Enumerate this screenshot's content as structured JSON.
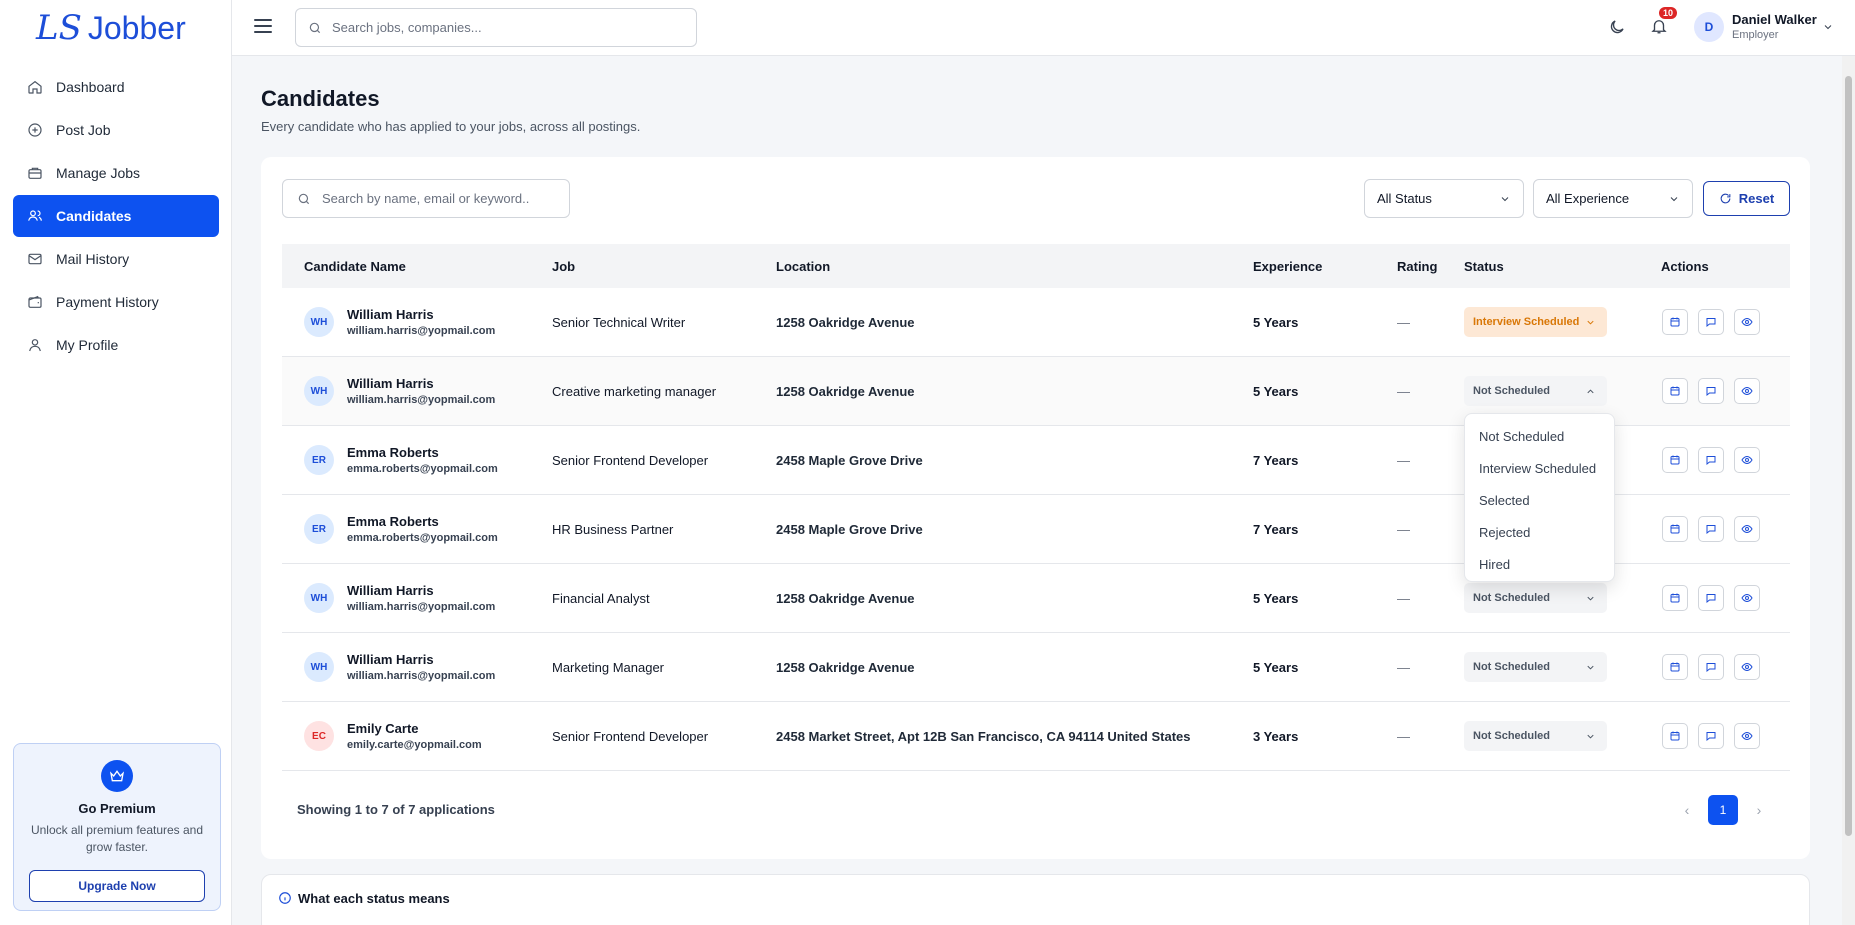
{
  "brand": {
    "logo_mark": "LS",
    "name": "Jobber"
  },
  "sidebar": {
    "items": [
      {
        "label": "Dashboard",
        "icon": "home-icon"
      },
      {
        "label": "Post Job",
        "icon": "plus-circle-icon"
      },
      {
        "label": "Manage Jobs",
        "icon": "briefcase-icon"
      },
      {
        "label": "Candidates",
        "icon": "users-icon",
        "active": true
      },
      {
        "label": "Mail History",
        "icon": "mail-icon"
      },
      {
        "label": "Payment History",
        "icon": "wallet-icon"
      },
      {
        "label": "My Profile",
        "icon": "user-icon"
      }
    ],
    "premium": {
      "title": "Go Premium",
      "text": "Unlock all premium features and grow faster.",
      "button": "Upgrade Now"
    }
  },
  "topbar": {
    "search_placeholder": "Search jobs, companies...",
    "notification_count": "10",
    "user": {
      "initial": "D",
      "name": "Daniel Walker",
      "role": "Employer"
    }
  },
  "page": {
    "title": "Candidates",
    "subtitle": "Every candidate who has applied to your jobs, across all postings."
  },
  "filters": {
    "search_placeholder": "Search by name, email or keyword..",
    "status_value": "All Status",
    "experience_value": "All Experience",
    "reset_label": "Reset"
  },
  "table": {
    "headers": [
      "Candidate Name",
      "Job",
      "Location",
      "Experience",
      "Rating",
      "Status",
      "Actions"
    ],
    "rows": [
      {
        "initials": "WH",
        "name": "William Harris",
        "email": "william.harris@yopmail.com",
        "job": "Senior Technical Writer",
        "location": "1258 Oakridge Avenue",
        "experience": "5 Years",
        "rating": "—",
        "status": "Interview Scheduled"
      },
      {
        "initials": "WH",
        "name": "William Harris",
        "email": "william.harris@yopmail.com",
        "job": "Creative marketing manager",
        "location": "1258 Oakridge Avenue",
        "experience": "5 Years",
        "rating": "—",
        "status": "Not Scheduled"
      },
      {
        "initials": "ER",
        "name": "Emma Roberts",
        "email": "emma.roberts@yopmail.com",
        "job": "Senior Frontend Developer",
        "location": "2458 Maple Grove Drive",
        "experience": "7 Years",
        "rating": "—",
        "status": ""
      },
      {
        "initials": "ER",
        "name": "Emma Roberts",
        "email": "emma.roberts@yopmail.com",
        "job": "HR Business Partner",
        "location": "2458 Maple Grove Drive",
        "experience": "7 Years",
        "rating": "—",
        "status": ""
      },
      {
        "initials": "WH",
        "name": "William Harris",
        "email": "william.harris@yopmail.com",
        "job": "Financial Analyst",
        "location": "1258 Oakridge Avenue",
        "experience": "5 Years",
        "rating": "—",
        "status": "Not Scheduled"
      },
      {
        "initials": "WH",
        "name": "William Harris",
        "email": "william.harris@yopmail.com",
        "job": "Marketing Manager",
        "location": "1258 Oakridge Avenue",
        "experience": "5 Years",
        "rating": "—",
        "status": "Not Scheduled"
      },
      {
        "initials": "EC",
        "name": "Emily Carte",
        "email": "emily.carte@yopmail.com",
        "job": "Senior Frontend Developer",
        "location": "2458 Market Street, Apt 12B San Francisco, CA 94114 United States",
        "experience": "3 Years",
        "rating": "—",
        "status": "Not Scheduled"
      }
    ]
  },
  "status_dropdown": {
    "options": [
      "Not Scheduled",
      "Interview Scheduled",
      "Selected",
      "Rejected",
      "Hired"
    ]
  },
  "pagination": {
    "summary": "Showing 1 to 7 of 7 applications",
    "prev": "‹",
    "current": "1",
    "next": "›"
  },
  "legend": {
    "title": "What each status means"
  },
  "colors": {
    "primary": "#0d52f0",
    "interview_scheduled_bg": "#fde8d5",
    "interview_scheduled_text": "#d97706"
  }
}
